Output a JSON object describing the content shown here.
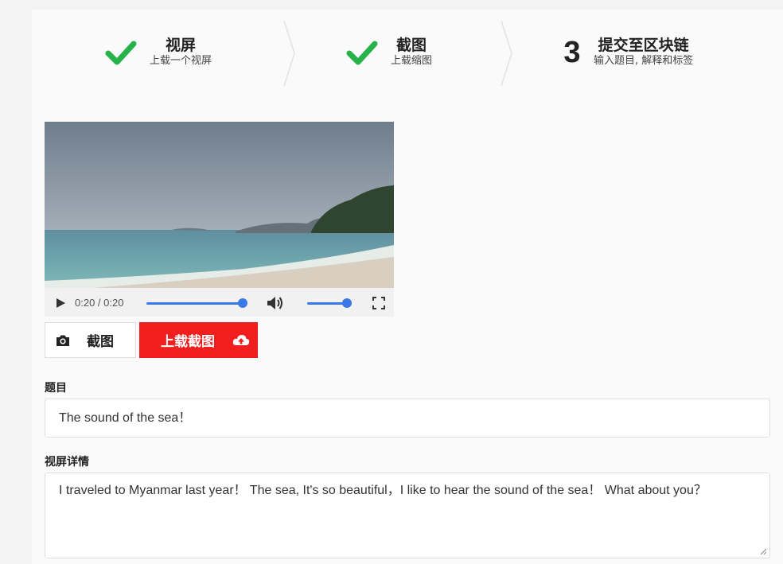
{
  "steps": [
    {
      "status": "done",
      "title": "视屏",
      "subtitle": "上载一个视屏"
    },
    {
      "status": "done",
      "title": "截图",
      "subtitle": "上载缩图"
    },
    {
      "status": "current",
      "number": "3",
      "title": "提交至区块链",
      "subtitle": "输入题目, 解释和标签"
    }
  ],
  "video": {
    "time": "0:20 / 0:20",
    "progress": 1.0,
    "volume": 1.0
  },
  "buttons": {
    "screenshot_label": "截图",
    "upload_label": "上载截图"
  },
  "form": {
    "title_label": "题目",
    "title_value": "The sound of the sea！",
    "details_label": "视屏详情",
    "details_value": "I traveled to Myanmar last year！ The sea, It's so beautiful，I like to hear the sound of the sea！ What about you？"
  },
  "colors": {
    "check": "#27b24a",
    "upload_button": "#f01e1e",
    "player_accent": "#3b78e7"
  }
}
